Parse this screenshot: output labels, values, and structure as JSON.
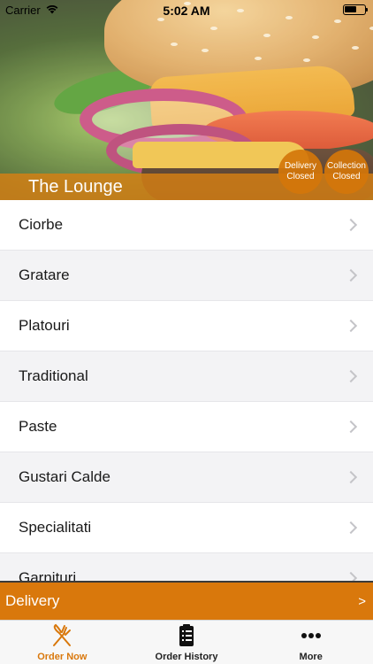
{
  "status_bar": {
    "carrier": "Carrier",
    "time": "5:02 AM",
    "battery_level": 0.6
  },
  "hero": {
    "venue_name": "The Lounge",
    "delivery_status": {
      "line1": "Delivery",
      "line2": "Closed"
    },
    "collection_status": {
      "line1": "Collection",
      "line2": "Closed"
    }
  },
  "menu": {
    "categories": [
      "Ciorbe",
      "Gratare",
      "Platouri",
      "Traditional",
      "Paste",
      "Gustari Calde",
      "Specialitati",
      "Garnituri"
    ]
  },
  "order_bar": {
    "label": "Delivery",
    "arrow": ">"
  },
  "tabbar": {
    "tabs": [
      {
        "label": "Order Now",
        "icon": "fork-knife-icon",
        "active": true
      },
      {
        "label": "Order History",
        "icon": "clipboard-list-icon",
        "active": false
      },
      {
        "label": "More",
        "icon": "more-dots-icon",
        "active": false
      }
    ]
  },
  "colors": {
    "accent": "#d9780c",
    "row_alt": "#f3f3f5",
    "chevron": "#c4c4c8"
  }
}
